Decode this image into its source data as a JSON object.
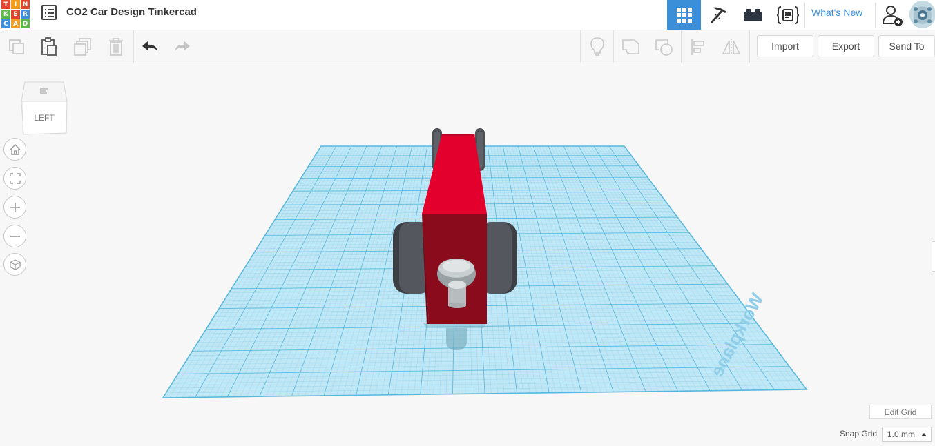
{
  "app": {
    "logo_letters": [
      "T",
      "I",
      "N",
      "K",
      "E",
      "R",
      "C",
      "A",
      "D"
    ],
    "logo_colors": [
      "#e2442f",
      "#f29c1e",
      "#e2442f",
      "#5cb848",
      "#e2442f",
      "#3c8fd8",
      "#3c8fd8",
      "#f29c1e",
      "#5cb848"
    ],
    "title": "CO2 Car Design Tinkercad"
  },
  "topbar": {
    "icons": [
      "grid-view-icon",
      "pickaxe-icon",
      "bricks-icon",
      "codeblocks-icon"
    ],
    "whats_new": "What's New",
    "active_color": "#3b8ed8"
  },
  "toolbar": {
    "import": "Import",
    "export": "Export",
    "send_to": "Send To"
  },
  "viewcube": {
    "face_label": "LEFT"
  },
  "workplane": {
    "label": "Workplane",
    "grid_color": "#8fd4ee",
    "car_body_color": "#e3002d",
    "wheel_color": "#4d5055"
  },
  "grid_controls": {
    "edit_grid": "Edit Grid",
    "snap_label": "Snap Grid",
    "snap_value": "1.0 mm"
  }
}
